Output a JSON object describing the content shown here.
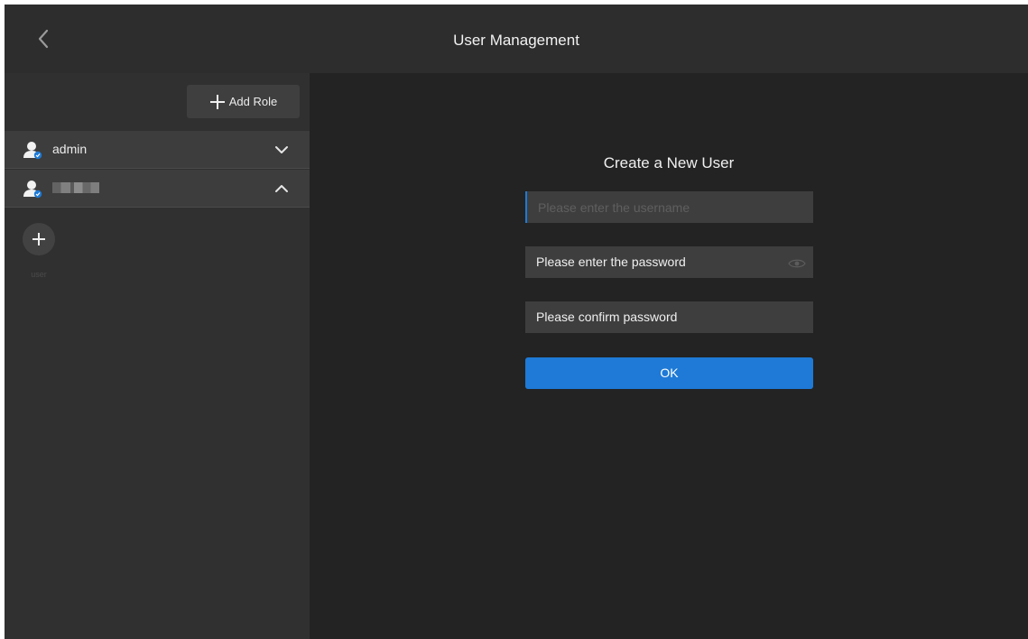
{
  "header": {
    "title": "User Management",
    "back_icon": "chevron-left-icon"
  },
  "sidebar": {
    "add_role_label": "Add Role",
    "add_role_icon": "plus-icon",
    "roles": [
      {
        "name": "admin",
        "icon": "user-avatar-icon",
        "expanded": false,
        "chevron": "chevron-down-icon"
      },
      {
        "name": "",
        "icon": "user-avatar-icon",
        "expanded": true,
        "chevron": "chevron-up-icon"
      }
    ],
    "add_user": {
      "icon": "plus-icon",
      "label": "user"
    }
  },
  "form": {
    "title": "Create a New User",
    "username_placeholder": "Please enter the username",
    "username_value": "",
    "password_text": "Please enter the password",
    "confirm_text": "Please confirm password",
    "ok_label": "OK"
  },
  "colors": {
    "accent": "#1e7ad6",
    "background": "#232323",
    "sidebar": "#303030",
    "topbar": "#2d2d2d"
  }
}
